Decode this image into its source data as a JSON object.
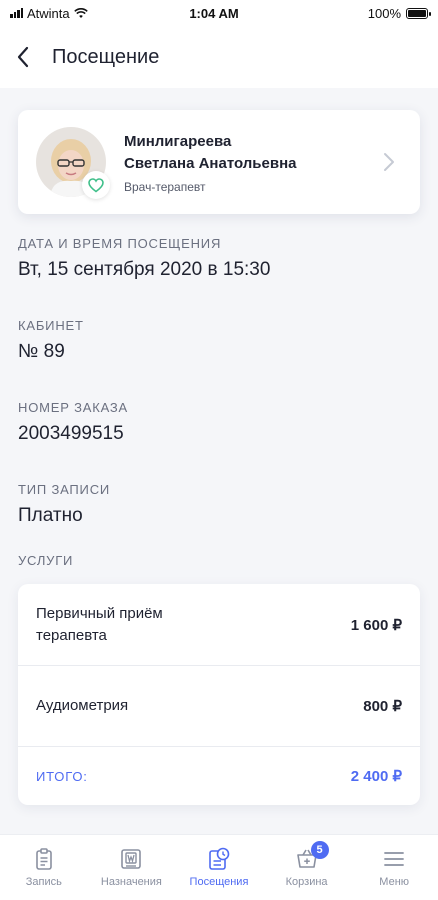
{
  "status_bar": {
    "carrier": "Atwinta",
    "time": "1:04 AM",
    "battery": "100%",
    "battery_level": 1.0
  },
  "header": {
    "title": "Посещение",
    "back_icon": "chevron-left-icon"
  },
  "doctor": {
    "surname": "Минлигареева",
    "given_names": "Светлана Анатольевна",
    "role": "Врач-терапевт"
  },
  "visit": {
    "datetime_label": "ДАТА И ВРЕМЯ ПОСЕЩЕНИЯ",
    "datetime_value": "Вт, 15 сентября 2020 в 15:30",
    "room_label": "КАБИНЕТ",
    "room_value": "№ 89",
    "order_label": "НОМЕР ЗАКАЗА",
    "order_value": "2003499515",
    "type_label": "ТИП ЗАПИСИ",
    "type_value": "Платно",
    "services_label": "УСЛУГИ"
  },
  "services": [
    {
      "name_line1": "Первичный приём",
      "name_line2": "терапевта",
      "price": "1 600 ₽"
    },
    {
      "name": "Аудиометрия",
      "price": "800 ₽"
    }
  ],
  "total": {
    "label": "ИТОГО:",
    "price": "2 400 ₽"
  },
  "tabbar": {
    "items": [
      {
        "label": "Запись",
        "icon": "clipboard-icon"
      },
      {
        "label": "Назначения",
        "icon": "prescription-icon"
      },
      {
        "label": "Посещения",
        "icon": "visits-clock-icon"
      },
      {
        "label": "Корзина",
        "icon": "cart-icon",
        "badge": "5"
      },
      {
        "label": "Меню",
        "icon": "menu-icon"
      }
    ],
    "active": "Посещения"
  },
  "colors": {
    "accent": "#4f6bf2",
    "favorite": "#3fbf8a",
    "text": "#1f2230",
    "muted": "#6b7080"
  }
}
